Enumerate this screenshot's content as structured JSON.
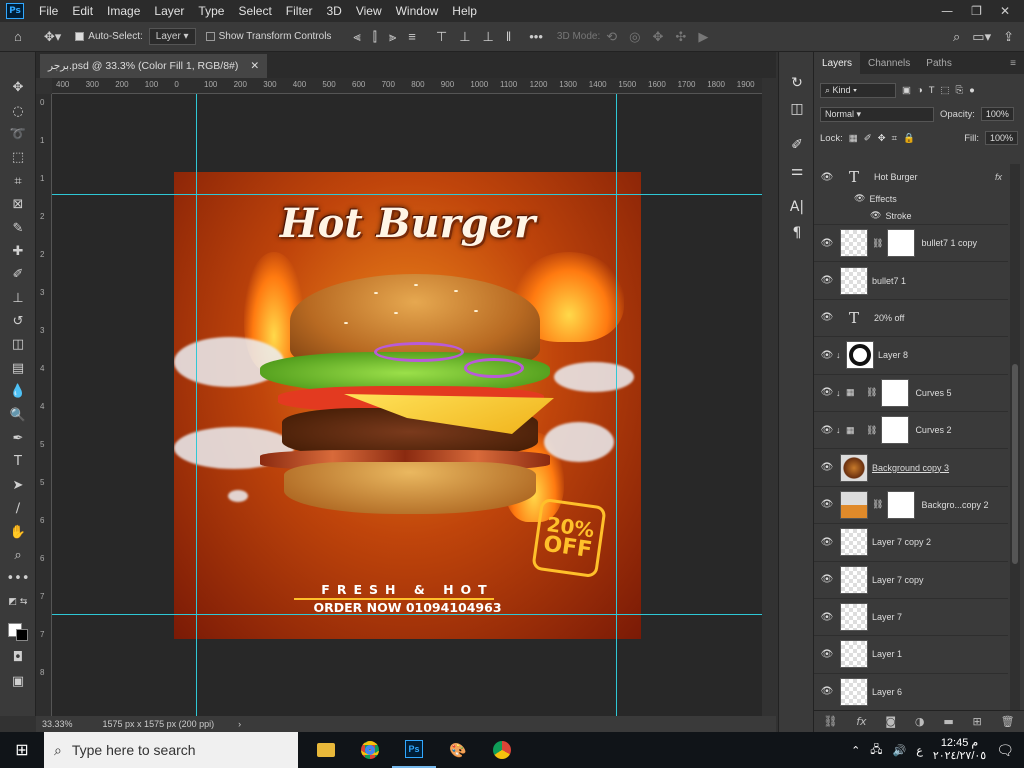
{
  "menu": {
    "items": [
      "File",
      "Edit",
      "Image",
      "Layer",
      "Type",
      "Select",
      "Filter",
      "3D",
      "View",
      "Window",
      "Help"
    ]
  },
  "options": {
    "auto_select_label": "Auto-Select:",
    "auto_select_value": "Layer",
    "show_transform_label": "Show Transform Controls",
    "mode_3d_label": "3D Mode:"
  },
  "document": {
    "tab_title": "برجر.psd @ 33.3% (Color Fill 1, RGB/8#)",
    "zoom": "33.33%",
    "doc_size": "1575 px x 1575 px (200 ppi)"
  },
  "ruler": {
    "h_ticks": [
      "400",
      "300",
      "200",
      "100",
      "0",
      "100",
      "200",
      "300",
      "400",
      "500",
      "600",
      "700",
      "800",
      "900",
      "1000",
      "1100",
      "1200",
      "1300",
      "1400",
      "1500",
      "1600",
      "1700",
      "1800",
      "1900"
    ],
    "v_ticks": [
      "0",
      "1",
      "1",
      "2",
      "2",
      "3",
      "3",
      "4",
      "4",
      "5",
      "5",
      "6",
      "6",
      "7",
      "7",
      "8"
    ]
  },
  "artwork": {
    "title": "Hot Burger",
    "badge_percent": "20%",
    "badge_off": "OFF",
    "fresh_text": "FRESH & HOT",
    "order_text": "ORDER NOW 01094104963"
  },
  "panel": {
    "tabs": [
      "Layers",
      "Channels",
      "Paths"
    ],
    "kind_label": "Kind",
    "blend_mode": "Normal",
    "opacity_label": "Opacity:",
    "opacity_value": "100%",
    "lock_label": "Lock:",
    "fill_label": "Fill:",
    "fill_value": "100%",
    "effects_label": "Effects",
    "stroke_label": "Stroke",
    "layers": [
      {
        "name": "Hot Burger",
        "kind": "text",
        "fx": true
      },
      {
        "name": "bullet7 1 copy",
        "kind": "smart-mask"
      },
      {
        "name": "bullet7 1",
        "kind": "smart"
      },
      {
        "name": "20%  off",
        "kind": "text"
      },
      {
        "name": "Layer 8",
        "kind": "clip-ring"
      },
      {
        "name": "Curves 5",
        "kind": "adjust-mask"
      },
      {
        "name": "Curves 2",
        "kind": "adjust-mask"
      },
      {
        "name": "Background copy 3",
        "kind": "burger"
      },
      {
        "name": "Backgro...copy 2",
        "kind": "burger-mask"
      },
      {
        "name": "Layer 7 copy 2",
        "kind": "pixel"
      },
      {
        "name": "Layer 7 copy",
        "kind": "pixel"
      },
      {
        "name": "Layer 7",
        "kind": "pixel"
      },
      {
        "name": "Layer 1",
        "kind": "pixel"
      },
      {
        "name": "Layer 6",
        "kind": "pixel"
      }
    ]
  },
  "taskbar": {
    "search_placeholder": "Type here to search",
    "time": "12:45 م",
    "date": "٢٠٢٤/٢٧/٠٥",
    "lang": "ع"
  },
  "colors": {
    "accent": "#31a8ff",
    "guide": "#2ec8d6",
    "badge": "#ffc02a"
  }
}
